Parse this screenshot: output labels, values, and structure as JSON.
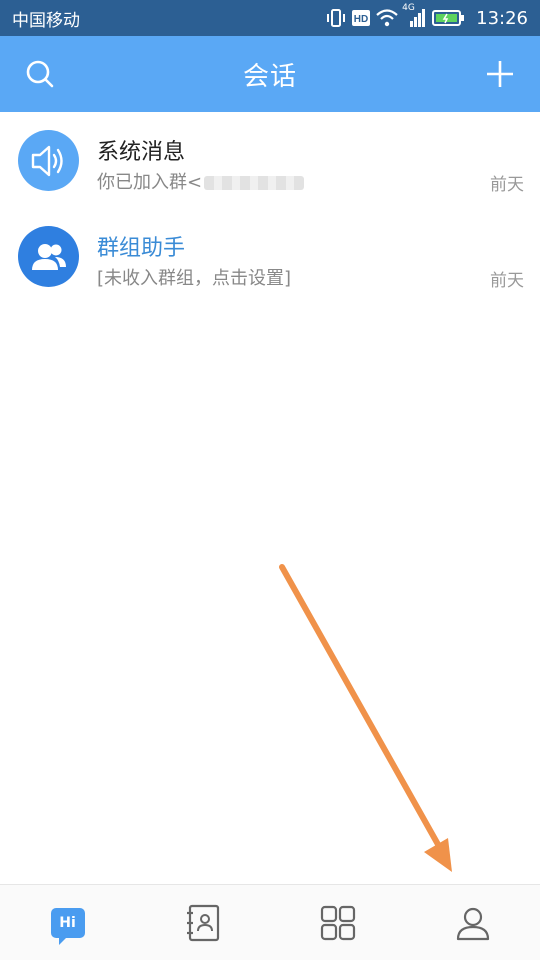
{
  "status_bar": {
    "carrier": "中国移动",
    "network": "4G",
    "time": "13:26"
  },
  "header": {
    "title": "会话"
  },
  "conversations": [
    {
      "title": "系统消息",
      "preview": "你已加入群<",
      "time": "前天",
      "avatar_icon": "speaker-icon"
    },
    {
      "title": "群组助手",
      "preview": "[未收入群组，点击设置]",
      "time": "前天",
      "avatar_icon": "group-icon"
    }
  ],
  "tabs": [
    {
      "icon": "chat-hi-icon",
      "label": "Hi",
      "active": true
    },
    {
      "icon": "contacts-icon"
    },
    {
      "icon": "apps-grid-icon"
    },
    {
      "icon": "profile-icon"
    }
  ],
  "colors": {
    "status_bar": "#2c5f93",
    "header": "#5aa8f5",
    "accent": "#4a9cf0",
    "annotation_arrow": "#f0924a"
  }
}
